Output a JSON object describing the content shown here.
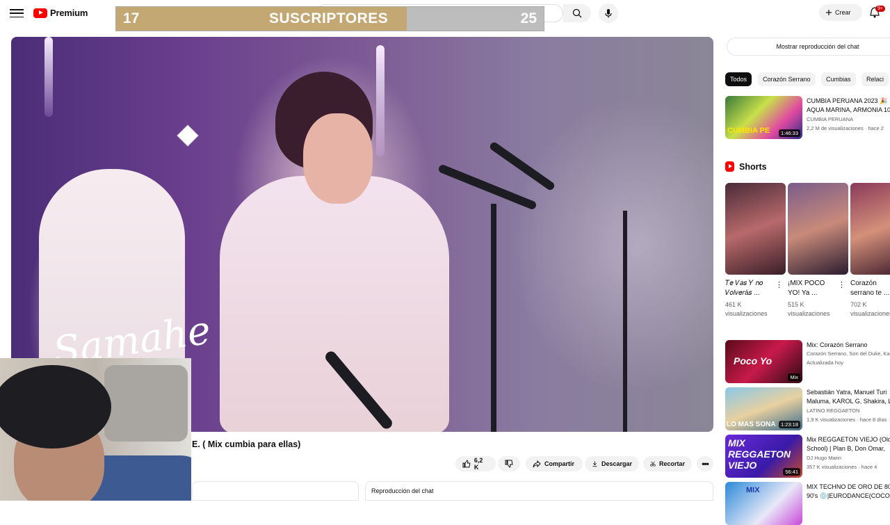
{
  "topbar": {
    "logo_text": "Premium",
    "create_label": "Crear",
    "notification_badge": "9+"
  },
  "subscriber_goal": {
    "current": "17",
    "label": "SUSCRIPTORES",
    "goal": "25",
    "progress_fraction": 0.68
  },
  "video": {
    "title_visible": "E. ( Mix cumbia para ellas)",
    "logo_text": "Samahe"
  },
  "actions": {
    "likes": "6,2 K",
    "share": "Compartir",
    "download": "Descargar",
    "clip": "Recortar"
  },
  "chat_replay_label": "Reproducción del chat",
  "sidebar": {
    "show_chat_label": "Mostrar reproducción del chat",
    "chips": [
      "Todos",
      "Corazón Serrano",
      "Cumbias",
      "Relaci"
    ],
    "recommendations": [
      {
        "title": "CUMBIA PERUANA 2023 🎉\nAQUA MARINA, ARMONIA 10",
        "channel": "CUMBIA PERUANA",
        "meta": "2,2 M de visualizaciones · hace 2",
        "duration": "1:46:33",
        "thumb_text": "CUMBIA PE"
      },
      {
        "title": "Mix: Corazón Serrano",
        "channel": "Corazón Serrano, Son del Duke, Ka",
        "meta": "Actualizada hoy",
        "duration": "Mix",
        "thumb_text": "Poco Yo"
      },
      {
        "title": "Sebastián Yatra, Manuel Turi\nMaluma, KAROL G, Shakira, L",
        "channel": "LATINO REGGAETON",
        "meta": "1,9 K visualizaciones · hace 8 días",
        "duration": "1:23:18",
        "thumb_text": "LO MAS SONA"
      },
      {
        "title": "Mix REGGAETON VIEJO (Old\nSchool) | Plan B, Don Omar,",
        "channel": "DJ Hugo Marin",
        "meta": "357 K visualizaciones · hace 4",
        "duration": "56:41",
        "thumb_text": "MIX REGGAETON VIEJO"
      },
      {
        "title": "MIX TECHNO DE ORO DE 80's\n90's 💿|EURODANCE(COCO",
        "channel": "",
        "meta": "",
        "duration": "",
        "thumb_text": "MIX"
      }
    ],
    "shorts_heading": "Shorts",
    "shorts": [
      {
        "title": "𝑇𝑒 𝑉𝑎𝑠 𝑌 𝑛𝑜\n𝑉𝑜𝑙𝑣𝑒𝑟á𝑠 ...",
        "views": "461 K\nvisualizaciones"
      },
      {
        "title": "¡MIX POCO\nYO! Ya ...",
        "views": "515 K\nvisualizaciones"
      },
      {
        "title": "Corazón\nserrano te ...",
        "views": "702 K\nvisualizaciones"
      }
    ]
  }
}
